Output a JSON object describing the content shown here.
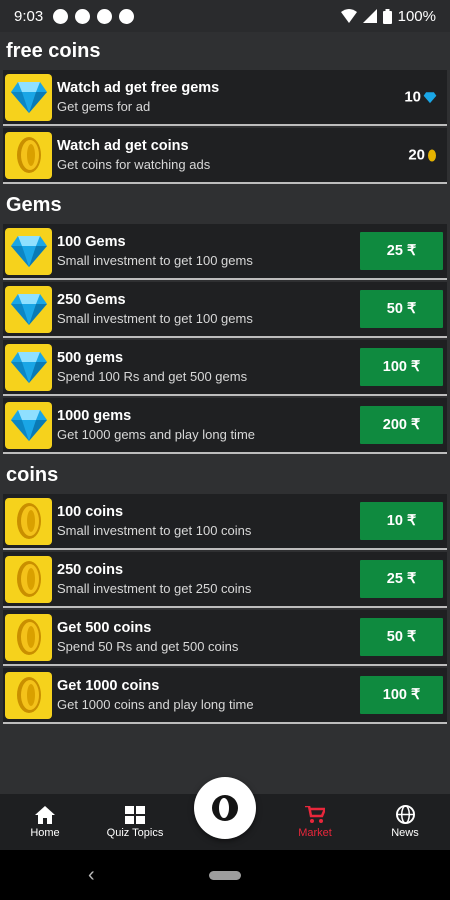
{
  "status": {
    "time": "9:03",
    "battery": "100%"
  },
  "sections": [
    {
      "title": "free coins",
      "items": [
        {
          "name": "Watch ad get free gems",
          "desc": "Get gems for ad",
          "icon": "gem-icon",
          "reward": "10",
          "reward_icon": "gem-icon"
        },
        {
          "name": "Watch ad get coins",
          "desc": "Get coins for  watching ads",
          "icon": "coin-icon",
          "reward": "20",
          "reward_icon": "coin-icon"
        }
      ]
    },
    {
      "title": "Gems",
      "items": [
        {
          "name": "100 Gems",
          "desc": "Small investment to get 100 gems",
          "icon": "gem-icon",
          "price": "25 ₹"
        },
        {
          "name": "250 Gems",
          "desc": "Small investment to get 100 gems",
          "icon": "gem-icon",
          "price": "50 ₹"
        },
        {
          "name": "500 gems",
          "desc": "Spend 100 Rs and get 500 gems",
          "icon": "gem-icon",
          "price": "100 ₹"
        },
        {
          "name": "1000 gems",
          "desc": "Get 1000 gems and play long time",
          "icon": "gem-icon",
          "price": "200 ₹"
        }
      ]
    },
    {
      "title": "coins",
      "items": [
        {
          "name": "100 coins",
          "desc": "Small investment to get 100 coins",
          "icon": "coin-icon",
          "price": "10 ₹"
        },
        {
          "name": "250 coins",
          "desc": "Small investment to get 250 coins",
          "icon": "coin-icon",
          "price": "25 ₹"
        },
        {
          "name": "Get 500 coins",
          "desc": "Spend 50 Rs and get 500 coins",
          "icon": "coin-icon",
          "price": "50 ₹"
        },
        {
          "name": "Get 1000 coins",
          "desc": "Get 1000 coins and play long time",
          "icon": "coin-icon",
          "price": "100 ₹"
        }
      ]
    }
  ],
  "nav": {
    "home": "Home",
    "quiz_topics": "Quiz Topics",
    "market": "Market",
    "news": "News"
  },
  "colors": {
    "price_button": "#0f8a3f",
    "active_tab": "#e8273b",
    "thumb_bg": "#f6d21c"
  }
}
